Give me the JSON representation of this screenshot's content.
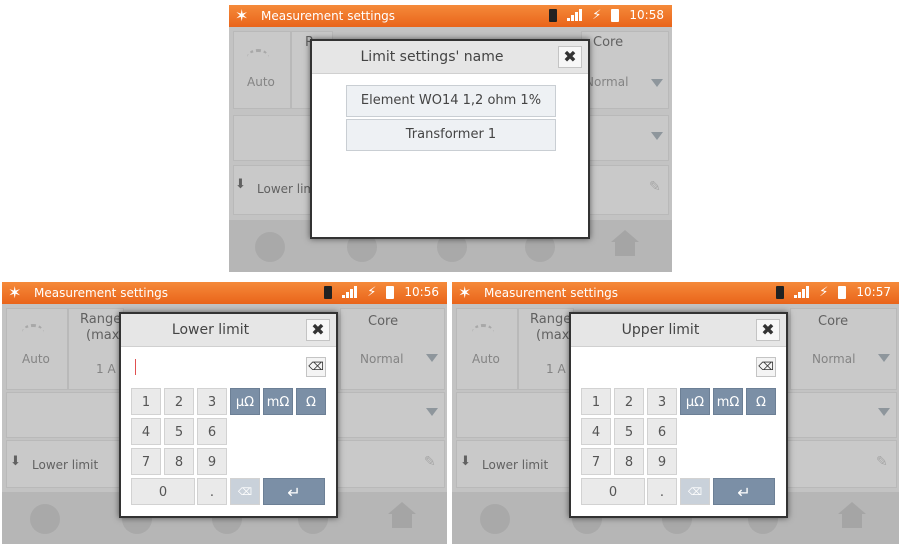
{
  "screens": [
    {
      "topbar": {
        "title": "Measurement settings",
        "time": "10:58"
      },
      "dialog": {
        "title": "Limit settings' name",
        "items": [
          "Element WO14 1,2 ohm 1%",
          "Transformer 1"
        ]
      },
      "background": {
        "auto": "Auto",
        "core": "Core",
        "normal": "Normal",
        "lower_limit": "Lower limit",
        "range_stub": "R"
      }
    },
    {
      "topbar": {
        "title": "Measurement settings",
        "time": "10:56"
      },
      "dialog": {
        "title": "Lower limit"
      },
      "background": {
        "auto": "Auto",
        "range": "Range",
        "range2": "(max",
        "one_a": "1 A",
        "core": "Core",
        "normal": "Normal",
        "lower_limit": "Lower limit",
        "t_stub": "t"
      }
    },
    {
      "topbar": {
        "title": "Measurement settings",
        "time": "10:57"
      },
      "dialog": {
        "title": "Upper limit"
      },
      "background": {
        "auto": "Auto",
        "range": "Range",
        "range2": "(max",
        "one_a": "1 A",
        "core": "Core",
        "normal": "Normal",
        "lower_limit": "Lower limit",
        "t_stub": "t"
      }
    }
  ],
  "keypad": {
    "digits": [
      "1",
      "2",
      "3",
      "4",
      "5",
      "6",
      "7",
      "8",
      "9",
      "0",
      "."
    ],
    "units": [
      "µΩ",
      "mΩ",
      "Ω"
    ],
    "delete": "⌫",
    "enter": "↵"
  },
  "icons": {
    "logo": "✶",
    "close": "✖",
    "eraser": "⌫",
    "plug": "⚡",
    "download": "⬇",
    "pencil": "✎"
  },
  "colors": {
    "topbar": "#ec6f21",
    "unit_key": "#7b8fa6"
  }
}
